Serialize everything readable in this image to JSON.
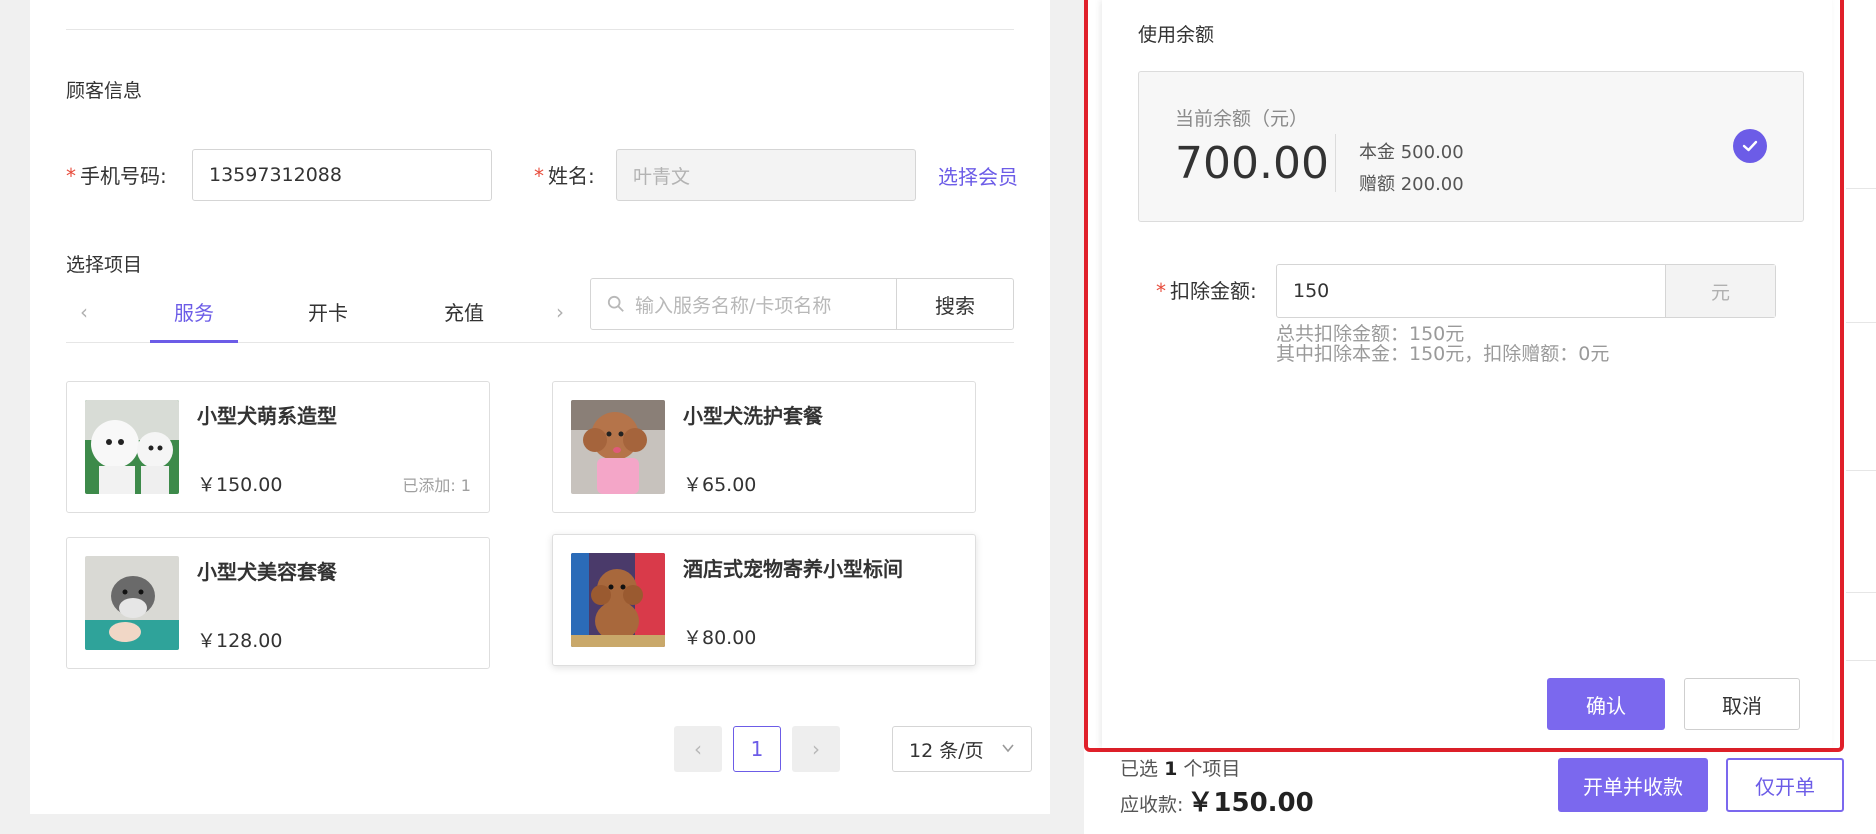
{
  "customer": {
    "section_title": "顾客信息",
    "phone_label": "手机号码:",
    "phone_value": "13597312088",
    "name_label": "姓名:",
    "name_value": "叶青文",
    "select_member": "选择会员"
  },
  "items": {
    "section_title": "选择项目",
    "tabs": [
      "服务",
      "开卡",
      "充值"
    ],
    "prev_arrow": "‹",
    "next_arrow": "›",
    "search_placeholder": "输入服务名称/卡项名称",
    "search_button": "搜索"
  },
  "products": [
    {
      "name": "小型犬萌系造型",
      "price": "￥150.00",
      "added": "已添加: 1"
    },
    {
      "name": "小型犬洗护套餐",
      "price": "￥65.00"
    },
    {
      "name": "小型犬美容套餐",
      "price": "￥128.00"
    },
    {
      "name": "酒店式宠物寄养小型标间",
      "price": "￥80.00"
    }
  ],
  "pagination": {
    "prev": "‹",
    "current": "1",
    "next": "›",
    "page_size": "12 条/页"
  },
  "modal": {
    "title": "使用余额",
    "balance_label": "当前余额（元）",
    "balance_amount": "700.00",
    "principal": "本金 500.00",
    "bonus": "赠额 200.00",
    "deduct_label": "扣除金额:",
    "deduct_value": "150",
    "deduct_unit": "元",
    "hint_total": "总共扣除金额：150元",
    "hint_detail": "其中扣除本金：150元，扣除赠额：0元",
    "confirm": "确认",
    "cancel": "取消"
  },
  "summary": {
    "selected_prefix": "已选",
    "selected_count": "1",
    "selected_suffix": "个项目",
    "receivable_label": "应收款:",
    "receivable_amount": "￥150.00",
    "order_and_pay": "开单并收款",
    "order_only": "仅开单"
  },
  "colors": {
    "accent": "#6c5ce7",
    "highlight_border": "#e0202a",
    "required": "#e74c3c"
  }
}
